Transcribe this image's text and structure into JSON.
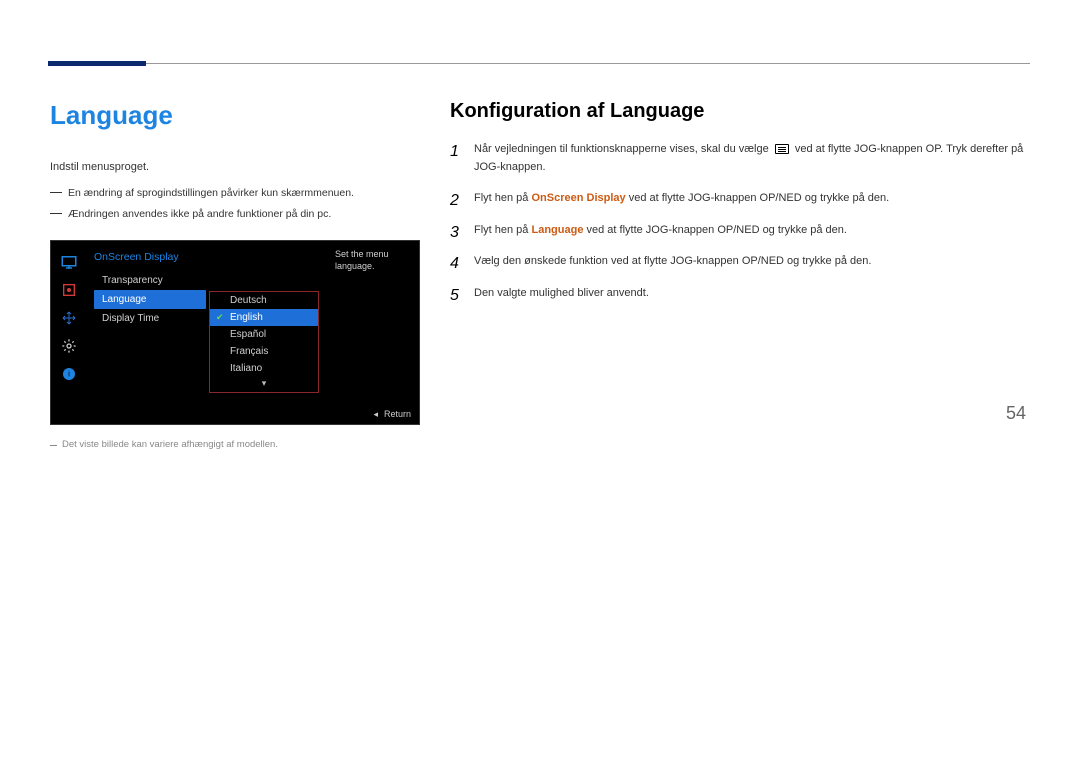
{
  "accent_color": "#1e84e2",
  "left": {
    "heading": "Language",
    "intro": "Indstil menusproget.",
    "note1": "En ændring af sprogindstillingen påvirker kun skærmmenuen.",
    "note2": "Ændringen anvendes ikke på andre funktioner på din pc.",
    "footnote": "Det viste billede kan variere afhængigt af modellen."
  },
  "osd": {
    "title": "OnScreen Display",
    "menu": [
      "Transparency",
      "Language",
      "Display Time"
    ],
    "selected_menu_index": 1,
    "submenu": [
      "Deutsch",
      "English",
      "Español",
      "Français",
      "Italiano"
    ],
    "selected_sub_index": 1,
    "help": "Set the menu language.",
    "return": "Return"
  },
  "right": {
    "heading": "Konfiguration af Language",
    "steps": [
      {
        "pre": "Når vejledningen til funktionsknapperne vises, skal du vælge ",
        "icon": true,
        "post": " ved at flytte JOG-knappen OP. Tryk derefter på JOG-knappen."
      },
      {
        "pre": "Flyt hen på ",
        "kw": "OnScreen Display",
        "post": " ved at flytte JOG-knappen OP/NED og trykke på den."
      },
      {
        "pre": "Flyt hen på ",
        "kw": "Language",
        "post": " ved at flytte JOG-knappen OP/NED og trykke på den."
      },
      {
        "pre": "Vælg den ønskede funktion ved at flytte JOG-knappen OP/NED og trykke på den.",
        "kw": "",
        "post": ""
      },
      {
        "pre": "Den valgte mulighed bliver anvendt.",
        "kw": "",
        "post": ""
      }
    ]
  },
  "page_number": "54"
}
